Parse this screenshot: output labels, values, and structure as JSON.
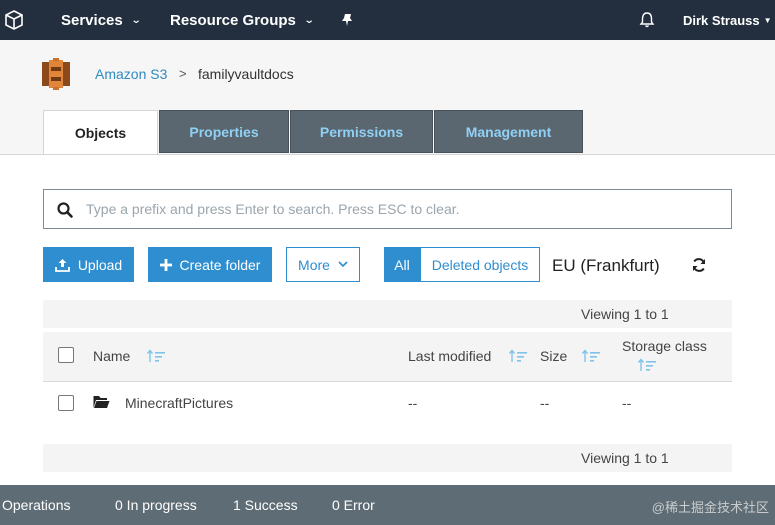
{
  "topnav": {
    "services": "Services",
    "resource_groups": "Resource Groups",
    "user": "Dirk Strauss"
  },
  "breadcrumb": {
    "root": "Amazon S3",
    "separator": ">",
    "bucket": "familyvaultdocs"
  },
  "tabs": [
    {
      "label": "Objects",
      "active": true
    },
    {
      "label": "Properties",
      "active": false
    },
    {
      "label": "Permissions",
      "active": false
    },
    {
      "label": "Management",
      "active": false
    }
  ],
  "search": {
    "placeholder": "Type a prefix and press Enter to search. Press ESC to clear.",
    "value": ""
  },
  "toolbar": {
    "upload": "Upload",
    "create_folder": "Create folder",
    "more": "More",
    "all": "All",
    "deleted_objects": "Deleted objects",
    "region": "EU (Frankfurt)"
  },
  "table": {
    "viewing": "Viewing 1 to 1",
    "columns": {
      "name": "Name",
      "last_modified": "Last modified",
      "size": "Size",
      "storage_class": "Storage class"
    },
    "rows": [
      {
        "name": "MinecraftPictures",
        "last_modified": "--",
        "size": "--",
        "storage_class": "--"
      }
    ]
  },
  "footer": {
    "operations": "Operations",
    "in_progress": "0 In progress",
    "success": "1 Success",
    "error": "0 Error",
    "watermark": "@稀土掘金技术社区"
  },
  "colors": {
    "nav_bg": "#232f3e",
    "accent": "#2e8ecf",
    "tab_inactive": "#5b6770",
    "footer_bg": "#5e6c75"
  }
}
